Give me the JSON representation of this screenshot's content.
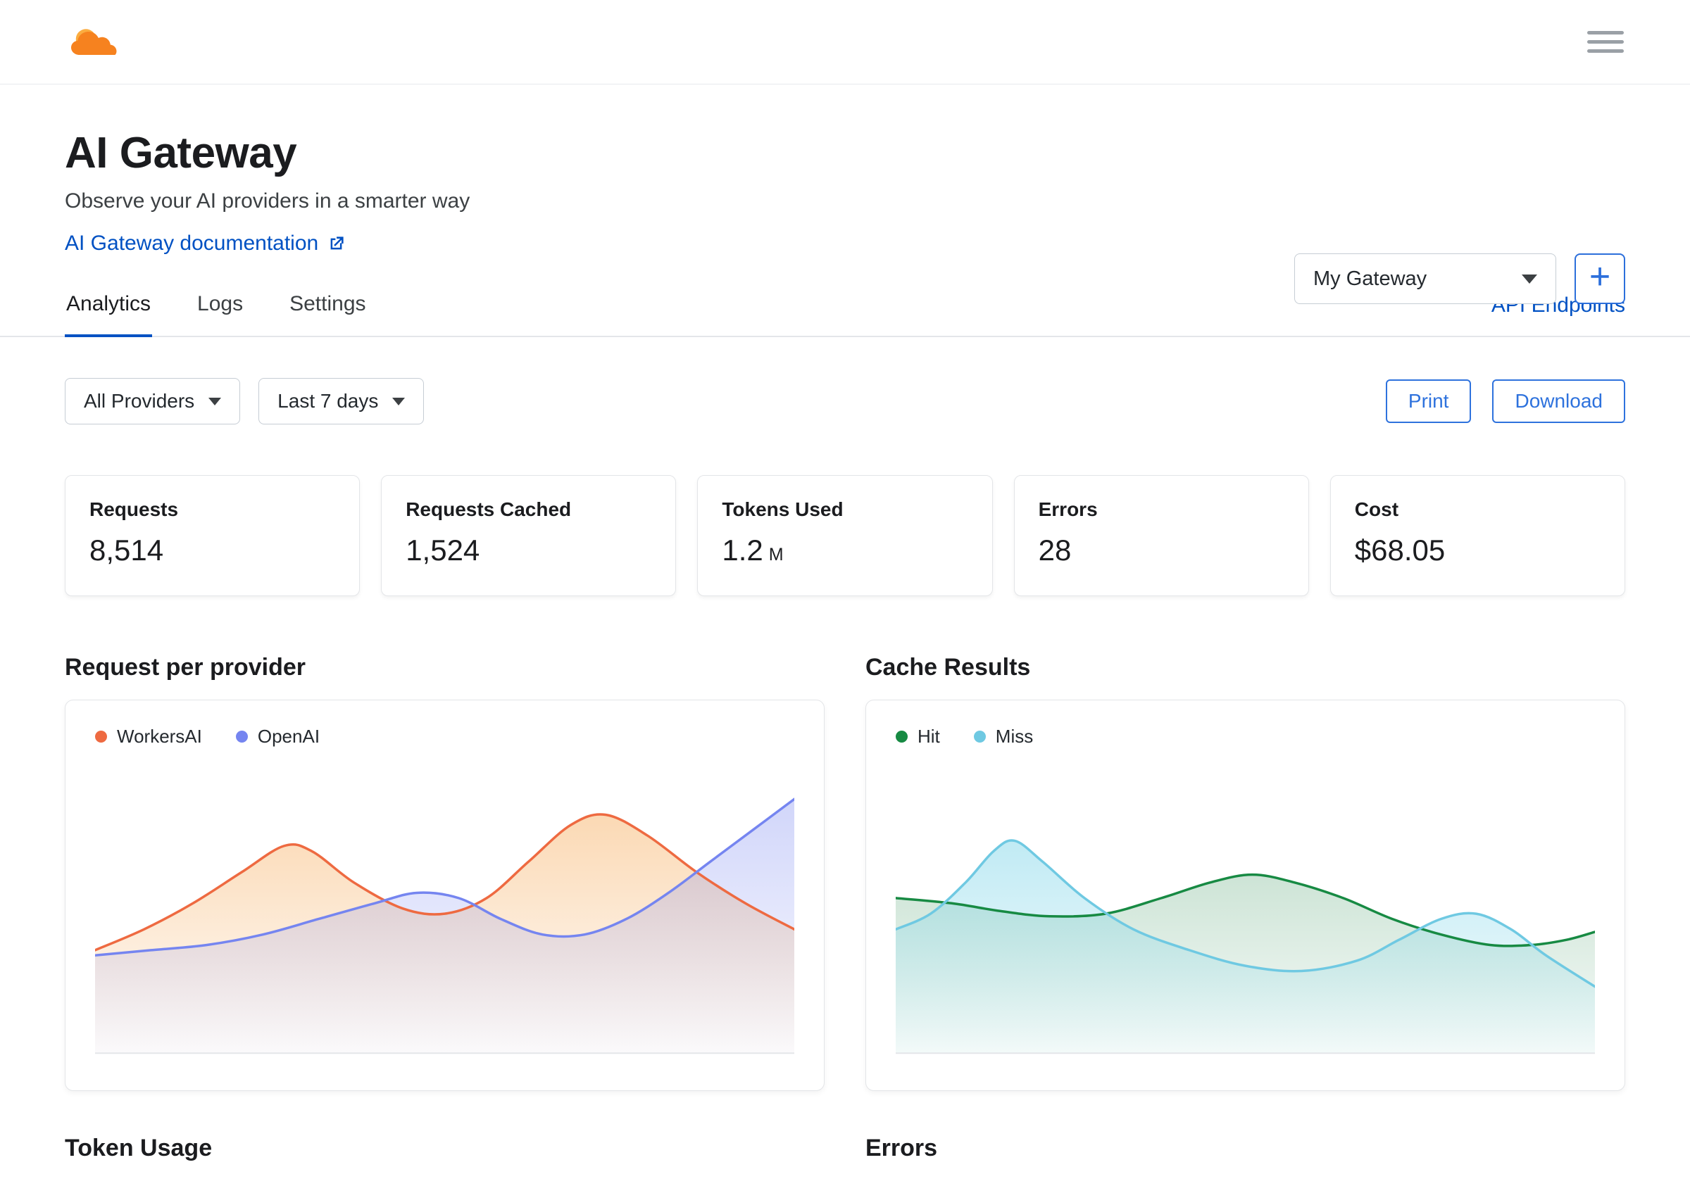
{
  "colors": {
    "accent_link": "#0051c3",
    "button_blue": "#2e72dd",
    "tab_underline": "#0051c3",
    "logo_orange": "#f6821f",
    "logo_orange_light": "#fbad41"
  },
  "header": {
    "title": "AI Gateway",
    "subtitle": "Observe your AI providers in a smarter way",
    "doc_link": "AI Gateway documentation",
    "gateway_select_value": "My Gateway",
    "add_button": "+"
  },
  "tabs": {
    "items": [
      {
        "label": "Analytics",
        "active": true
      },
      {
        "label": "Logs",
        "active": false
      },
      {
        "label": "Settings",
        "active": false
      }
    ],
    "right_link": "API Endpoints"
  },
  "filters": {
    "providers_value": "All Providers",
    "range_value": "Last 7 days",
    "print_label": "Print",
    "download_label": "Download"
  },
  "stats": [
    {
      "label": "Requests",
      "value": "8,514",
      "unit": ""
    },
    {
      "label": "Requests Cached",
      "value": "1,524",
      "unit": ""
    },
    {
      "label": "Tokens Used",
      "value": "1.2",
      "unit": "M"
    },
    {
      "label": "Errors",
      "value": "28",
      "unit": ""
    },
    {
      "label": "Cost",
      "value": "$68.05",
      "unit": ""
    }
  ],
  "sections": {
    "chart1_title": "Request per provider",
    "chart2_title": "Cache Results",
    "bottom1_title": "Token Usage",
    "bottom2_title": "Errors"
  },
  "chart_data": [
    {
      "type": "area",
      "title": "Request per provider",
      "legend_position": "top-left",
      "axes_visible": false,
      "y_unit": "relative 0-100",
      "series": [
        {
          "name": "WorkersAI",
          "color": "#ee6a41",
          "fill_top": "rgba(246,170,88,0.45)",
          "fill_bottom": "rgba(246,170,88,0.02)",
          "points": [
            [
              0,
              38
            ],
            [
              7,
              46
            ],
            [
              14,
              56
            ],
            [
              21,
              68
            ],
            [
              27,
              78
            ],
            [
              31,
              76
            ],
            [
              37,
              64
            ],
            [
              44,
              54
            ],
            [
              50,
              52
            ],
            [
              56,
              58
            ],
            [
              62,
              72
            ],
            [
              68,
              86
            ],
            [
              73,
              90
            ],
            [
              79,
              82
            ],
            [
              86,
              68
            ],
            [
              93,
              56
            ],
            [
              100,
              46
            ]
          ]
        },
        {
          "name": "OpenAI",
          "color": "#7585f0",
          "fill_top": "rgba(120,134,240,0.34)",
          "fill_bottom": "rgba(120,134,240,0.03)",
          "points": [
            [
              0,
              36
            ],
            [
              8,
              38
            ],
            [
              16,
              40
            ],
            [
              24,
              44
            ],
            [
              32,
              50
            ],
            [
              40,
              56
            ],
            [
              46,
              60
            ],
            [
              52,
              58
            ],
            [
              58,
              50
            ],
            [
              64,
              44
            ],
            [
              70,
              44
            ],
            [
              76,
              50
            ],
            [
              82,
              60
            ],
            [
              88,
              72
            ],
            [
              94,
              84
            ],
            [
              100,
              96
            ]
          ]
        }
      ]
    },
    {
      "type": "area",
      "title": "Cache Results",
      "legend_position": "top-left",
      "axes_visible": false,
      "y_unit": "relative 0-100",
      "series": [
        {
          "name": "Hit",
          "color": "#178a43",
          "fill_top": "rgba(60,150,95,0.26)",
          "fill_bottom": "rgba(60,150,95,0.03)",
          "points": [
            [
              0,
              58
            ],
            [
              8,
              56
            ],
            [
              15,
              53
            ],
            [
              22,
              51
            ],
            [
              30,
              52
            ],
            [
              38,
              58
            ],
            [
              45,
              64
            ],
            [
              51,
              67
            ],
            [
              57,
              64
            ],
            [
              64,
              58
            ],
            [
              71,
              50
            ],
            [
              78,
              44
            ],
            [
              85,
              40
            ],
            [
              91,
              40
            ],
            [
              96,
              42
            ],
            [
              100,
              45
            ]
          ]
        },
        {
          "name": "Miss",
          "color": "#6fc9e2",
          "fill_top": "rgba(130,214,233,0.50)",
          "fill_bottom": "rgba(130,214,233,0.05)",
          "points": [
            [
              0,
              46
            ],
            [
              5,
              52
            ],
            [
              10,
              64
            ],
            [
              14,
              76
            ],
            [
              17,
              80
            ],
            [
              21,
              72
            ],
            [
              27,
              58
            ],
            [
              34,
              46
            ],
            [
              42,
              38
            ],
            [
              50,
              32
            ],
            [
              58,
              30
            ],
            [
              66,
              34
            ],
            [
              72,
              42
            ],
            [
              78,
              50
            ],
            [
              83,
              52
            ],
            [
              88,
              46
            ],
            [
              93,
              36
            ],
            [
              100,
              24
            ]
          ]
        }
      ]
    }
  ]
}
